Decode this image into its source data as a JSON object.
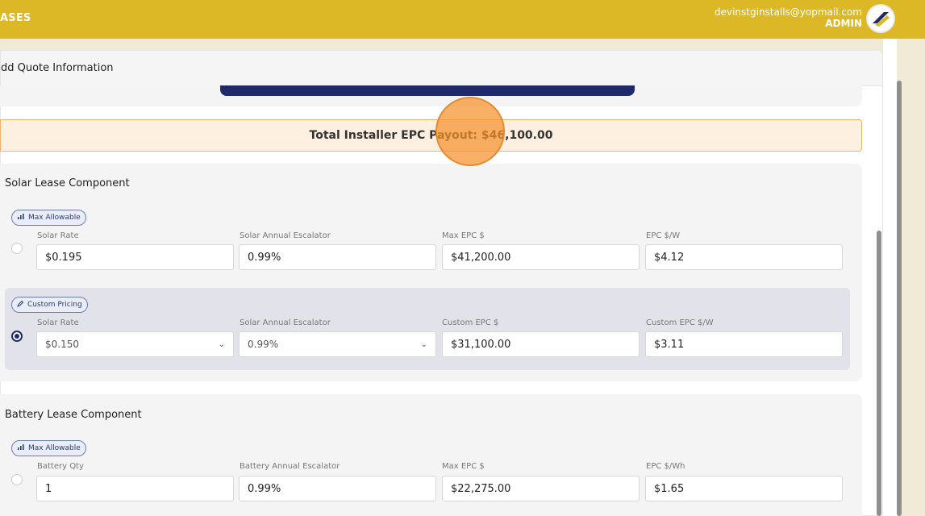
{
  "header": {
    "brand": "ASES",
    "user_email": "devinstginstalls@yopmail.com",
    "user_role": "ADMIN",
    "logo_icon": "company-logo"
  },
  "panel": {
    "title": "dd Quote Information"
  },
  "payout": {
    "text": "Total Installer EPC Payout: $46,100.00"
  },
  "solar": {
    "title": "Solar Lease Component",
    "max_badge": "Max Allowable",
    "custom_badge": "Custom Pricing",
    "max_row": {
      "labels": [
        "Solar Rate",
        "Solar Annual Escalator",
        "Max EPC $",
        "EPC $/W"
      ],
      "values": [
        "$0.195",
        "0.99%",
        "$41,200.00",
        "$4.12"
      ]
    },
    "custom_row": {
      "labels": [
        "Solar Rate",
        "Solar Annual Escalator",
        "Custom EPC $",
        "Custom EPC $/W"
      ],
      "values": [
        "$0.150",
        "0.99%",
        "$31,100.00",
        "$3.11"
      ]
    }
  },
  "battery": {
    "title": "Battery Lease Component",
    "max_badge": "Max Allowable",
    "max_row": {
      "labels": [
        "Battery Qty",
        "Battery Annual Escalator",
        "Max EPC $",
        "EPC $/Wh"
      ],
      "values": [
        "1",
        "0.99%",
        "$22,275.00",
        "$1.65"
      ]
    }
  },
  "colors": {
    "header_bg": "#dcb827",
    "accent_navy": "#1f2a6b",
    "payout_border": "#f0b36e"
  }
}
